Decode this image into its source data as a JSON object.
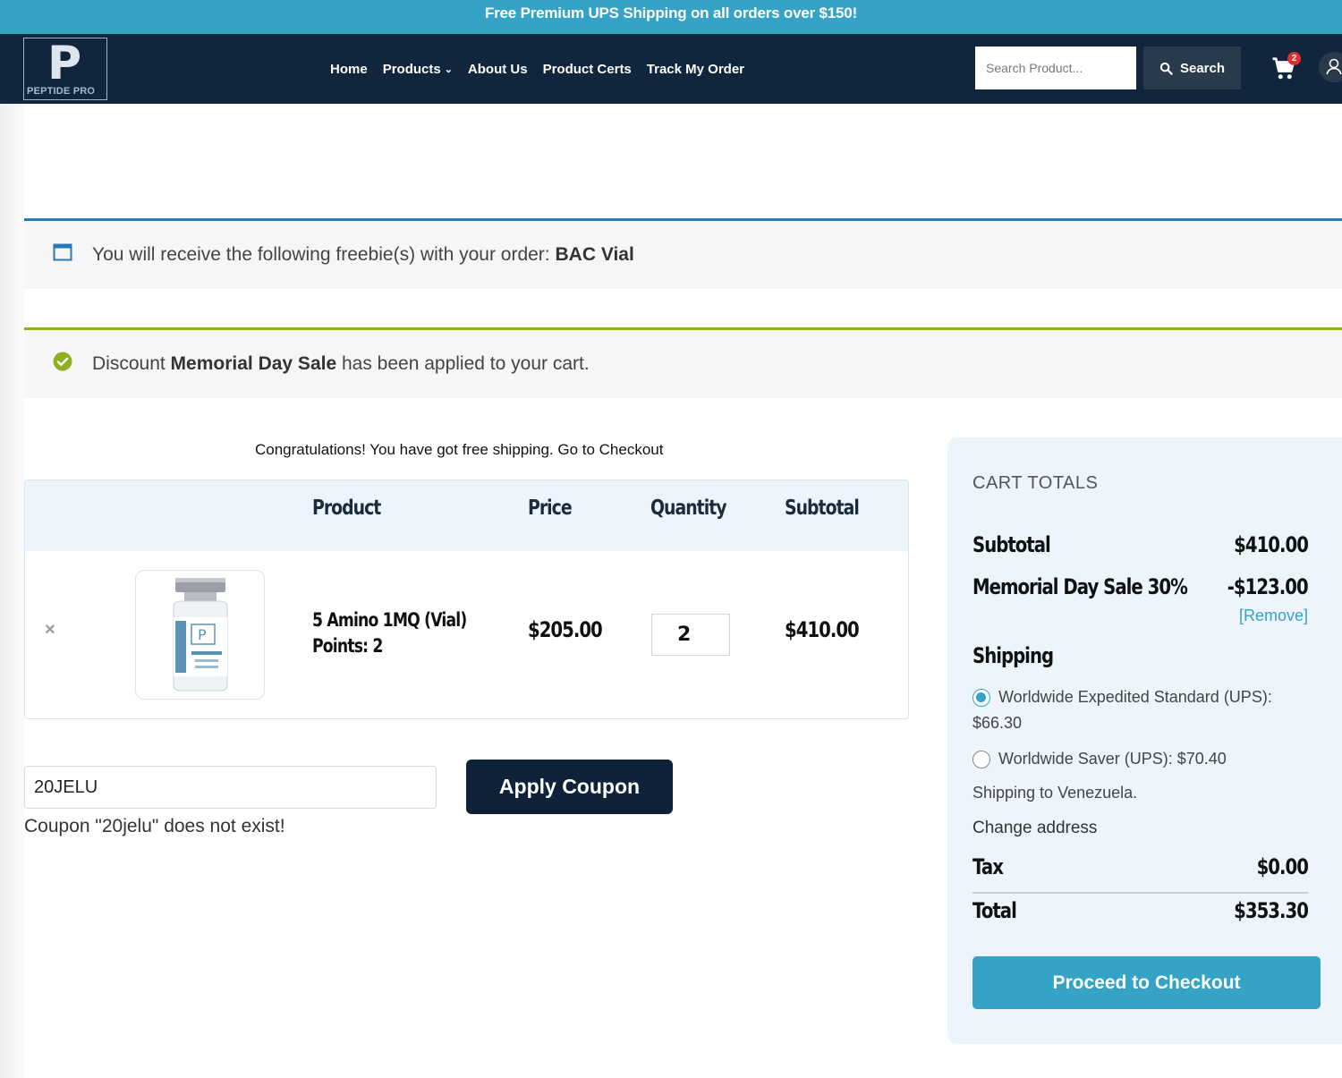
{
  "promo": {
    "text": "Free Premium UPS Shipping on all orders over $150!"
  },
  "brand": {
    "letter": "P",
    "name": "PEPTIDE PRO"
  },
  "nav": {
    "home": "Home",
    "products": "Products",
    "about": "About Us",
    "certs": "Product Certs",
    "track": "Track My Order"
  },
  "search": {
    "placeholder": "Search Product...",
    "button": "Search"
  },
  "cart": {
    "count": "2"
  },
  "notices": {
    "freebie_prefix": "You will receive the following freebie(s) with your order:",
    "freebie_item": "BAC Vial",
    "discount_prefix": "Discount",
    "discount_name": "Memorial Day Sale",
    "discount_suffix": "has been applied to your cart."
  },
  "free_shipping_msg": "Congratulations! You have got free shipping. Go to Checkout",
  "table": {
    "headers": {
      "product": "Product",
      "price": "Price",
      "quantity": "Quantity",
      "subtotal": "Subtotal"
    },
    "rows": [
      {
        "name": "5 Amino 1MQ (Vial)",
        "points": "Points: 2",
        "price": "$205.00",
        "quantity": "2",
        "subtotal": "$410.00"
      }
    ]
  },
  "coupon": {
    "value": "20JELU",
    "button": "Apply Coupon",
    "error": "Coupon \"20jelu\" does not exist!"
  },
  "totals": {
    "heading": "CART TOTALS",
    "subtotal_label": "Subtotal",
    "subtotal_value": "$410.00",
    "discount_label": "Memorial Day Sale 30%",
    "discount_value": "-$123.00",
    "remove": "[Remove]",
    "shipping_label": "Shipping",
    "option1_a": "Worldwide Expedited Standard (UPS):",
    "option1_b": "$66.30",
    "option2": "Worldwide Saver (UPS): $70.40",
    "shipping_to": "Shipping to Venezuela.",
    "change_address": "Change address",
    "tax_label": "Tax",
    "tax_value": "$0.00",
    "total_label": "Total",
    "total_value": "$353.30",
    "checkout": "Proceed to Checkout"
  },
  "colors": {
    "accent": "#35a3c6",
    "header": "#11263d",
    "button_dark": "#0f2238",
    "info": "#2a78b5",
    "success": "#8fb020"
  }
}
